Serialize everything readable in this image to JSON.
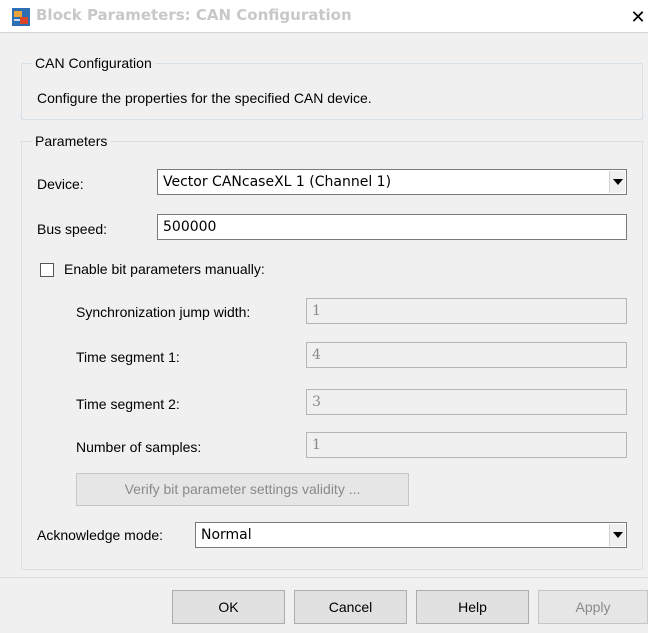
{
  "window": {
    "title": "Block Parameters: CAN Configuration",
    "close_glyph": "✕"
  },
  "description_group": {
    "legend": "CAN Configuration",
    "text": "Configure the properties for the specified CAN device."
  },
  "parameters": {
    "legend": "Parameters",
    "device": {
      "label": "Device:",
      "value": "Vector CANcaseXL 1 (Channel 1)"
    },
    "bus_speed": {
      "label": "Bus speed:",
      "value": "500000"
    },
    "enable_bit_params": {
      "label": "Enable bit parameters manually:",
      "checked": false
    },
    "sync_jump_width": {
      "label": "Synchronization jump width:",
      "value": "1"
    },
    "time_segment_1": {
      "label": "Time segment 1:",
      "value": "4"
    },
    "time_segment_2": {
      "label": "Time segment 2:",
      "value": "3"
    },
    "number_of_samples": {
      "label": "Number of samples:",
      "value": "1"
    },
    "verify_button": "Verify bit parameter settings validity ...",
    "acknowledge_mode": {
      "label": "Acknowledge mode:",
      "value": "Normal"
    }
  },
  "buttons": {
    "ok": "OK",
    "cancel": "Cancel",
    "help": "Help",
    "apply": "Apply"
  },
  "icons": {
    "window_icon": "simulink-block-icon",
    "dropdown_icon": "chevron-down-icon"
  }
}
